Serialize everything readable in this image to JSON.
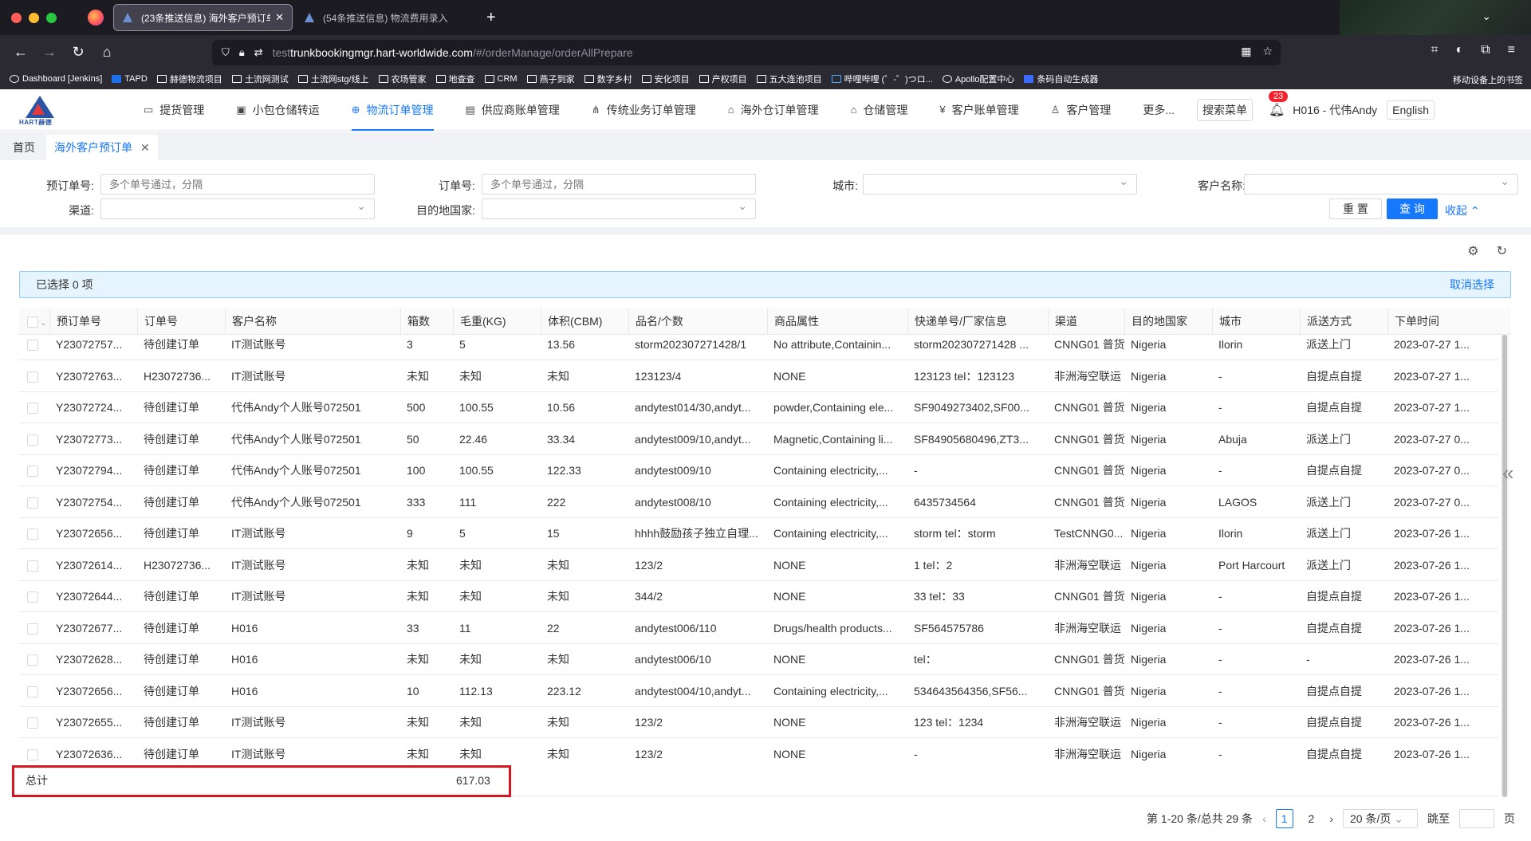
{
  "browser": {
    "tabs": [
      {
        "title": "(23条推送信息) 海外客户预订单",
        "active": true
      },
      {
        "title": "(54条推送信息) 物流费用录入",
        "active": false
      }
    ],
    "url_scheme": "test",
    "url_host": "trunkbookingmgr.hart-worldwide.com",
    "url_path": "/#/orderManage/orderAllPrepare",
    "bookmarks": [
      "Dashboard [Jenkins]",
      "TAPD",
      "赫德物流项目",
      "土流网测试",
      "土流网stg/线上",
      "农场管家",
      "地查查",
      "CRM",
      "燕子到家",
      "数字乡村",
      "安化项目",
      "产权项目",
      "五大连池项目",
      "哔哩哔哩 (゜-゜)つロ...",
      "Apollo配置中心",
      "条码自动生成器"
    ],
    "mobile_bookmarks": "移动设备上的书签"
  },
  "app": {
    "logo_text": "HART赫德",
    "menu": [
      {
        "label": "提货管理",
        "icon": "truck-icon",
        "active": false
      },
      {
        "label": "小包仓储转运",
        "icon": "package-icon",
        "active": false
      },
      {
        "label": "物流订单管理",
        "icon": "globe-icon",
        "active": true
      },
      {
        "label": "供应商账单管理",
        "icon": "bill-icon",
        "active": false
      },
      {
        "label": "传统业务订单管理",
        "icon": "network-icon",
        "active": false
      },
      {
        "label": "海外仓订单管理",
        "icon": "warehouse-icon",
        "active": false
      },
      {
        "label": "仓储管理",
        "icon": "home-icon",
        "active": false
      },
      {
        "label": "客户账单管理",
        "icon": "yen-icon",
        "active": false
      },
      {
        "label": "客户管理",
        "icon": "user-icon",
        "active": false
      }
    ],
    "more_label": "更多...",
    "search_menu_label": "搜索菜单",
    "notification_count": "23",
    "user_name": "H016 - 代伟Andy",
    "language_label": "English"
  },
  "page_tabs": [
    {
      "label": "首页",
      "active": false
    },
    {
      "label": "海外客户预订单",
      "active": true
    }
  ],
  "filters": {
    "booking_no_label": "预订单号:",
    "booking_no_placeholder": "多个单号通过，分隔",
    "order_no_label": "订单号:",
    "order_no_placeholder": "多个单号通过，分隔",
    "city_label": "城市:",
    "customer_label": "客户名称:",
    "channel_label": "渠道:",
    "country_label": "目的地国家:",
    "reset_label": "重 置",
    "query_label": "查 询",
    "collapse_label": "收起"
  },
  "selection": {
    "text": "已选择  0  项",
    "cancel_label": "取消选择"
  },
  "table": {
    "columns": [
      "预订单号",
      "订单号",
      "客户名称",
      "箱数",
      "毛重(KG)",
      "体积(CBM)",
      "品名/个数",
      "商品属性",
      "快递单号/厂家信息",
      "渠道",
      "目的地国家",
      "城市",
      "派送方式",
      "下单时间"
    ],
    "rows": [
      [
        "Y23072757...",
        "待创建订单",
        "IT测试账号",
        "3",
        "5",
        "13.56",
        "storm202307271428/1",
        "No attribute,Containin...",
        "storm202307271428 ...",
        "CNNG01 普货",
        "Nigeria",
        "Ilorin",
        "派送上门",
        "2023-07-27 1..."
      ],
      [
        "Y23072763...",
        "H23072736...",
        "IT测试账号",
        "未知",
        "未知",
        "未知",
        "123123/4",
        "NONE",
        "123123 tel：123123",
        "非洲海空联运",
        "Nigeria",
        "-",
        "自提点自提",
        "2023-07-27 1..."
      ],
      [
        "Y23072724...",
        "待创建订单",
        "代伟Andy个人账号072501",
        "500",
        "100.55",
        "10.56",
        "andytest014/30,andyt...",
        "powder,Containing ele...",
        "SF9049273402,SF00...",
        "CNNG01 普货",
        "Nigeria",
        "-",
        "自提点自提",
        "2023-07-27 1..."
      ],
      [
        "Y23072773...",
        "待创建订单",
        "代伟Andy个人账号072501",
        "50",
        "22.46",
        "33.34",
        "andytest009/10,andyt...",
        "Magnetic,Containing li...",
        "SF84905680496,ZT3...",
        "CNNG01 普货",
        "Nigeria",
        "Abuja",
        "派送上门",
        "2023-07-27 0..."
      ],
      [
        "Y23072794...",
        "待创建订单",
        "代伟Andy个人账号072501",
        "100",
        "100.55",
        "122.33",
        "andytest009/10",
        "Containing electricity,...",
        "-",
        "CNNG01 普货",
        "Nigeria",
        "-",
        "自提点自提",
        "2023-07-27 0..."
      ],
      [
        "Y23072754...",
        "待创建订单",
        "代伟Andy个人账号072501",
        "333",
        "111",
        "222",
        "andytest008/10",
        "Containing electricity,...",
        "6435734564",
        "CNNG01 普货",
        "Nigeria",
        "LAGOS",
        "派送上门",
        "2023-07-27 0..."
      ],
      [
        "Y23072656...",
        "待创建订单",
        "IT测试账号",
        "9",
        "5",
        "15",
        "hhhh鼓励孩子独立自理...",
        "Containing electricity,...",
        "storm tel：storm",
        "TestCNNG0...",
        "Nigeria",
        "Ilorin",
        "派送上门",
        "2023-07-26 1..."
      ],
      [
        "Y23072614...",
        "H23072736...",
        "IT测试账号",
        "未知",
        "未知",
        "未知",
        "123/2",
        "NONE",
        "1 tel：2",
        "非洲海空联运",
        "Nigeria",
        "Port Harcourt",
        "派送上门",
        "2023-07-26 1..."
      ],
      [
        "Y23072644...",
        "待创建订单",
        "IT测试账号",
        "未知",
        "未知",
        "未知",
        "344/2",
        "NONE",
        "33 tel：33",
        "CNNG01 普货",
        "Nigeria",
        "-",
        "自提点自提",
        "2023-07-26 1..."
      ],
      [
        "Y23072677...",
        "待创建订单",
        "H016",
        "33",
        "11",
        "22",
        "andytest006/110",
        "Drugs/health products...",
        "SF564575786",
        "非洲海空联运",
        "Nigeria",
        "-",
        "自提点自提",
        "2023-07-26 1..."
      ],
      [
        "Y23072628...",
        "待创建订单",
        "H016",
        "未知",
        "未知",
        "未知",
        "andytest006/10",
        "NONE",
        "tel：",
        "CNNG01 普货",
        "Nigeria",
        "-",
        "-",
        "2023-07-26 1..."
      ],
      [
        "Y23072656...",
        "待创建订单",
        "H016",
        "10",
        "112.13",
        "223.12",
        "andytest004/10,andyt...",
        "Containing electricity,...",
        "534643564356,SF56...",
        "CNNG01 普货",
        "Nigeria",
        "-",
        "自提点自提",
        "2023-07-26 1..."
      ],
      [
        "Y23072655...",
        "待创建订单",
        "IT测试账号",
        "未知",
        "未知",
        "未知",
        "123/2",
        "NONE",
        "123 tel：1234",
        "非洲海空联运",
        "Nigeria",
        "-",
        "自提点自提",
        "2023-07-26 1..."
      ],
      [
        "Y23072636...",
        "待创建订单",
        "IT测试账号",
        "未知",
        "未知",
        "未知",
        "123/2",
        "NONE",
        "-",
        "非洲海空联运",
        "Nigeria",
        "-",
        "自提点自提",
        "2023-07-26 1..."
      ]
    ],
    "summary_label": "总计",
    "summary_weight": "617.03"
  },
  "pagination": {
    "range_text": "第 1-20 条/总共 29 条",
    "pages": [
      "1",
      "2"
    ],
    "current": "1",
    "page_size": "20 条/页",
    "jump_label": "跳至",
    "page_suffix": "页"
  },
  "colors": {
    "accent": "#1677ff",
    "highlight_border": "#d9141c"
  }
}
